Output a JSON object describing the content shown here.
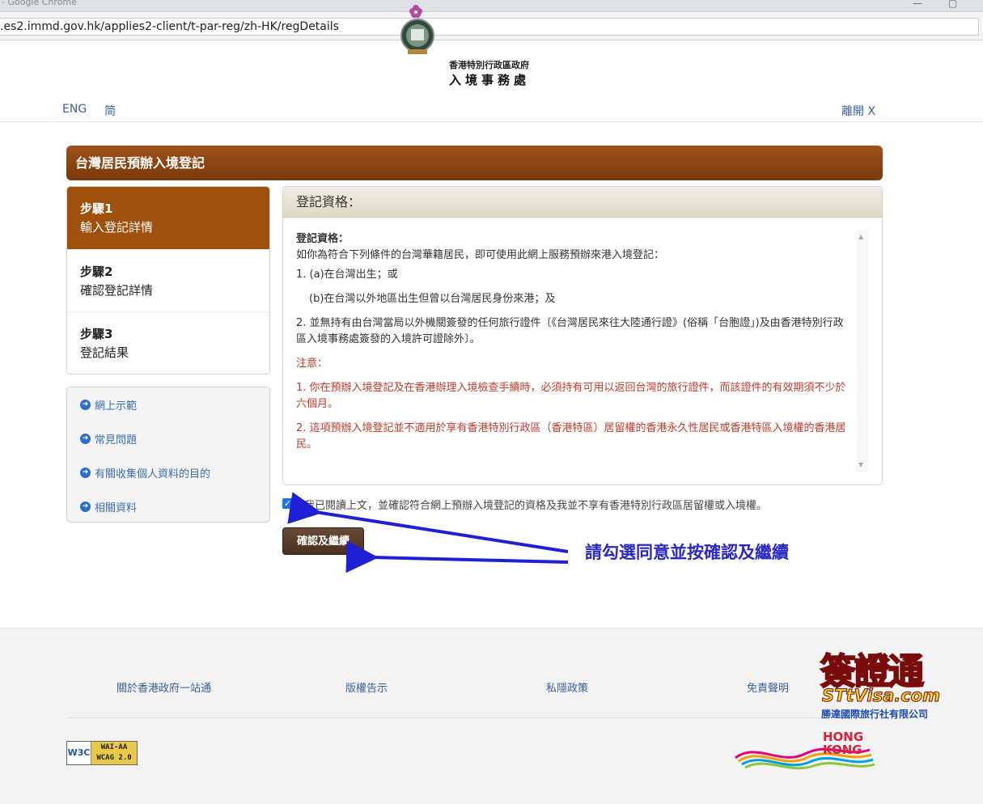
{
  "browser": {
    "title": "- Google Chrome",
    "url": ".es2.immd.gov.hk/applies2-client/t-par-reg/zh-HK/regDetails"
  },
  "header": {
    "logo_line1": "香港特別行政區政府",
    "logo_line2": "入境事務處",
    "lang_eng": "ENG",
    "lang_sc": "简",
    "exit": "離開 X"
  },
  "page_title": "台灣居民預辦入境登記",
  "steps": [
    {
      "num": "步驟1",
      "label": "輸入登記詳情",
      "active": true
    },
    {
      "num": "步驟2",
      "label": "確認登記詳情",
      "active": false
    },
    {
      "num": "步驟3",
      "label": "登記結果",
      "active": false
    }
  ],
  "side_links": [
    "網上示範",
    "常見問題",
    "有關收集個人資料的目的",
    "相關資料"
  ],
  "panel": {
    "header": "登記資格：",
    "heading": "登記資格：",
    "intro": "如你為符合下列條件的台灣華籍居民，即可使用此網上服務預辦來港入境登記：",
    "cond1a": "1. (a)在台灣出生；或",
    "cond1b": "(b)在台灣以外地區出生但曾以台灣居民身份來港；及",
    "cond2": "2. 並無持有由台灣當局以外機關簽發的任何旅行證件〔《台灣居民來往大陸通行證》(俗稱「台胞證」)及由香港特別行政區入境事務處簽發的入境許可證除外〕。",
    "note_title": "注意：",
    "note1": "1. 你在預辦入境登記及在香港辦理入境檢查手續時，必須持有可用以返回台灣的旅行證件，而該證件的有效期須不少於六個月。",
    "note2": "2. 這項預辦入境登記並不適用於享有香港特別行政區（香港特區）居留權的香港永久性居民或香港特區入境權的香港居民。"
  },
  "confirm": {
    "checked": true,
    "text": "我已閱讀上文，並確認符合網上預辦入境登記的資格及我並不享有香港特別行政區居留權或入境權。",
    "button": "確認及繼續"
  },
  "annotation": "請勾選同意並按確認及繼續",
  "footer": {
    "links": [
      "關於香港政府一站通",
      "版權告示",
      "私隱政策",
      "免責聲明"
    ],
    "w3c_left": "W3C",
    "w3c_line1": "WAI-AA",
    "w3c_line2": "WCAG 2.0",
    "hk_line1": "HONG",
    "hk_line2": "KONG"
  },
  "watermark": {
    "chinese": "簽證通",
    "site": "STtVisa.com",
    "company": "勝達國際旅行社有限公司"
  },
  "colors": {
    "brown_bar": "#8d4512",
    "active_step": "#a0500d",
    "link_blue": "#3a5f9a",
    "annotation_blue": "#2b28c8",
    "note_red": "#c0392b"
  }
}
